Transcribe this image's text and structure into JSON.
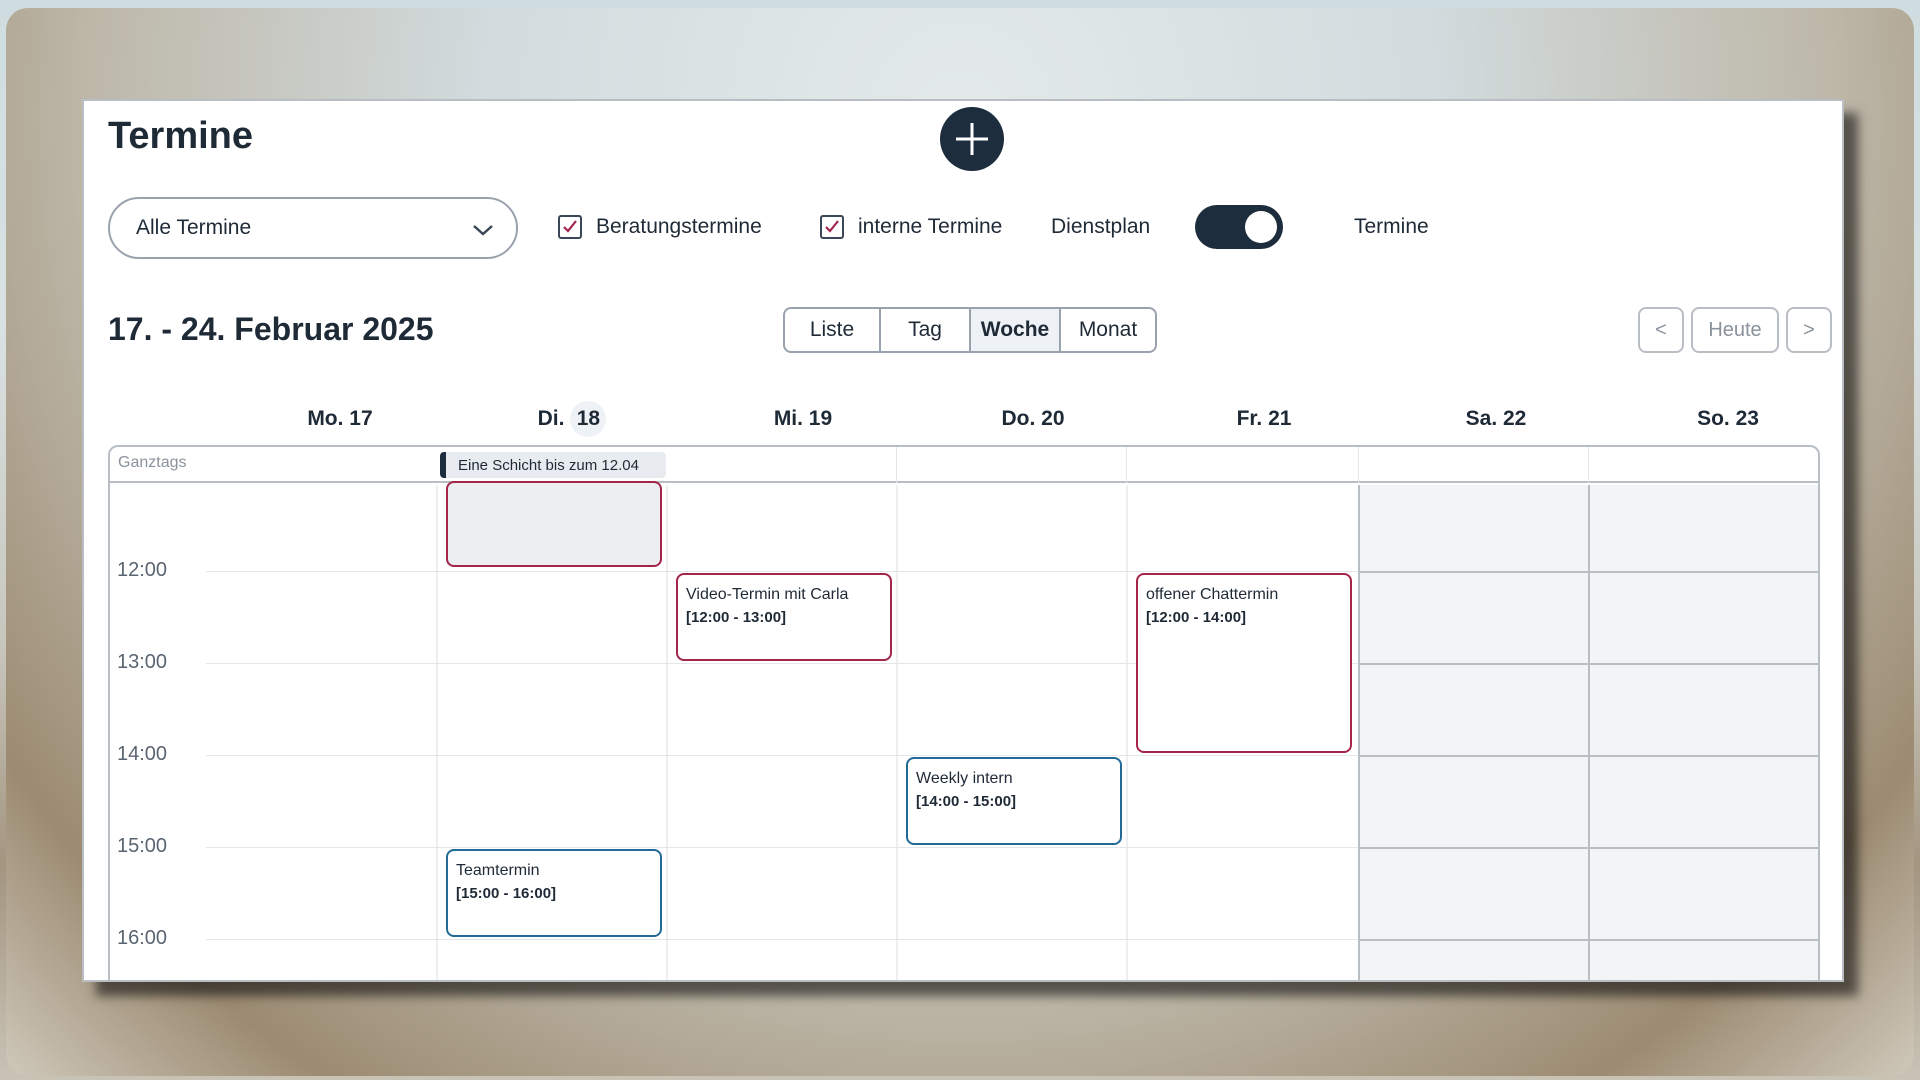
{
  "header": {
    "title": "Termine",
    "add_button_icon": "plus-icon"
  },
  "filters": {
    "select_value": "Alle Termine",
    "checkbox_beratung": "Beratungstermine",
    "checkbox_intern": "interne Termine",
    "toggle_left": "Dienstplan",
    "toggle_right": "Termine"
  },
  "toolbar": {
    "range": "17. - 24. Februar 2025",
    "views": [
      "Liste",
      "Tag",
      "Woche",
      "Monat"
    ],
    "active_view": "Woche",
    "prev": "<",
    "today": "Heute",
    "next": ">"
  },
  "days": {
    "mo": "Mo. 17",
    "di_prefix": "Di.",
    "di_num": "18",
    "mi": "Mi. 19",
    "do": "Do. 20",
    "fr": "Fr. 21",
    "sa": "Sa. 22",
    "so": "So. 23"
  },
  "allday": {
    "label": "Ganztags",
    "event": "Eine Schicht bis zum 12.04"
  },
  "hours": [
    "12:00",
    "13:00",
    "14:00",
    "15:00",
    "16:00"
  ],
  "events": {
    "video": {
      "title": "Video-Termin mit Carla",
      "time": "[12:00 - 13:00]"
    },
    "chat": {
      "title": "offener Chattermin",
      "time": "[12:00 - 14:00]"
    },
    "weekly": {
      "title": "Weekly intern",
      "time": "[14:00 - 15:00]"
    },
    "team": {
      "title": "Teamtermin",
      "time": "[15:00 - 16:00]"
    }
  },
  "colors": {
    "primary": "#1e2d3d",
    "beratung_border": "#a4254a",
    "intern_border": "#236a97"
  }
}
